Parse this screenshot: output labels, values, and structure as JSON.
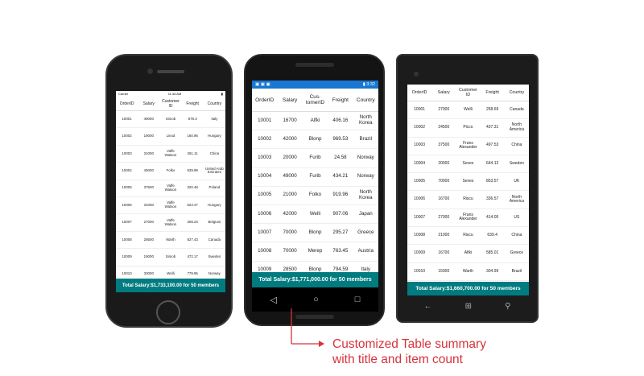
{
  "iphone": {
    "status": {
      "carrier": "Carrier",
      "time": "11:46 AM"
    },
    "headers": [
      "OrderID",
      "Salary",
      "Customer ID",
      "Freight",
      "Country"
    ],
    "rows": [
      [
        "10001",
        "49000",
        "Simob",
        "878.3",
        "Italy"
      ],
      [
        "10002",
        "19000",
        "Linod",
        "160.96",
        "Hungary"
      ],
      [
        "10003",
        "31000",
        "Vaffe Watson",
        "261.11",
        "China"
      ],
      [
        "10004",
        "45000",
        "Folko",
        "639.89",
        "United Arab Emirates"
      ],
      [
        "10005",
        "37500",
        "Vaffe Watson",
        "320.48",
        "Poland"
      ],
      [
        "10006",
        "31000",
        "Vaffe Watson",
        "623.47",
        "Hungary"
      ],
      [
        "10007",
        "27000",
        "Vaffe Watson",
        "208.24",
        "Belgium"
      ],
      [
        "10008",
        "28500",
        "Warth",
        "827.43",
        "Canada"
      ],
      [
        "10009",
        "19000",
        "Simob",
        "472.17",
        "Sweden"
      ],
      [
        "10010",
        "33000",
        "Welli",
        "779.95",
        "Norway"
      ],
      [
        "10011",
        "24500",
        "Folig",
        "11.45",
        "Belgium"
      ]
    ],
    "summary": "Total Salary:$1,733,100.00 for 50 members"
  },
  "android": {
    "status": {
      "time": "3:32"
    },
    "headers": [
      "OrderID",
      "Salary",
      "Cus-tomerID",
      "Freight",
      "Country"
    ],
    "rows": [
      [
        "10001",
        "16700",
        "Alfki",
        "406.16",
        "North Korea"
      ],
      [
        "10002",
        "42000",
        "Blonp",
        "969.53",
        "Brazil"
      ],
      [
        "10003",
        "20000",
        "Furib",
        "24.58",
        "Norway"
      ],
      [
        "10004",
        "49000",
        "Furib",
        "434.21",
        "Norway"
      ],
      [
        "10005",
        "21000",
        "Folko",
        "919.96",
        "North Korea"
      ],
      [
        "10006",
        "42000",
        "Welli",
        "907.06",
        "Japan"
      ],
      [
        "10007",
        "70000",
        "Blonp",
        "295.27",
        "Greece"
      ],
      [
        "10008",
        "70000",
        "Merep",
        "763.45",
        "Austria"
      ],
      [
        "10009",
        "28500",
        "Blonp",
        "794.59",
        "Italy"
      ]
    ],
    "summary": "Total Salary:$1,771,000.00 for 50 members"
  },
  "winphone": {
    "headers": [
      "OrderID",
      "Salary",
      "Customer ID",
      "Freight",
      "Country"
    ],
    "rows": [
      [
        "10001",
        "27000",
        "Welli",
        "258.69",
        "Canada"
      ],
      [
        "10002",
        "24500",
        "Picco",
        "437.31",
        "North America"
      ],
      [
        "10003",
        "37500",
        "Frans Alexander",
        "497.53",
        "China"
      ],
      [
        "10004",
        "20000",
        "Seves",
        "644.12",
        "Sweden"
      ],
      [
        "10005",
        "70000",
        "Seves",
        "853.57",
        "UK"
      ],
      [
        "10006",
        "16700",
        "Riscu",
        "336.57",
        "North America"
      ],
      [
        "10007",
        "27000",
        "Frans Alexander",
        "414.05",
        "US"
      ],
      [
        "10008",
        "21000",
        "Riscu",
        "639.4",
        "China"
      ],
      [
        "10009",
        "16700",
        "Alfki",
        "585.01",
        "Greece"
      ],
      [
        "10010",
        "15000",
        "Warth",
        "304.99",
        "Brazil"
      ],
      [
        "10011",
        "24500",
        "Welli",
        "981.14",
        "Poland"
      ]
    ],
    "summary": "Total Salary:$1,660,700.00 for 50 members"
  },
  "callout": {
    "line1": "Customized Table summary",
    "line2": "with title and item count",
    "color": "#d8333b"
  },
  "colors": {
    "summary_bg": "#007b7f",
    "android_status": "#1976d2"
  }
}
